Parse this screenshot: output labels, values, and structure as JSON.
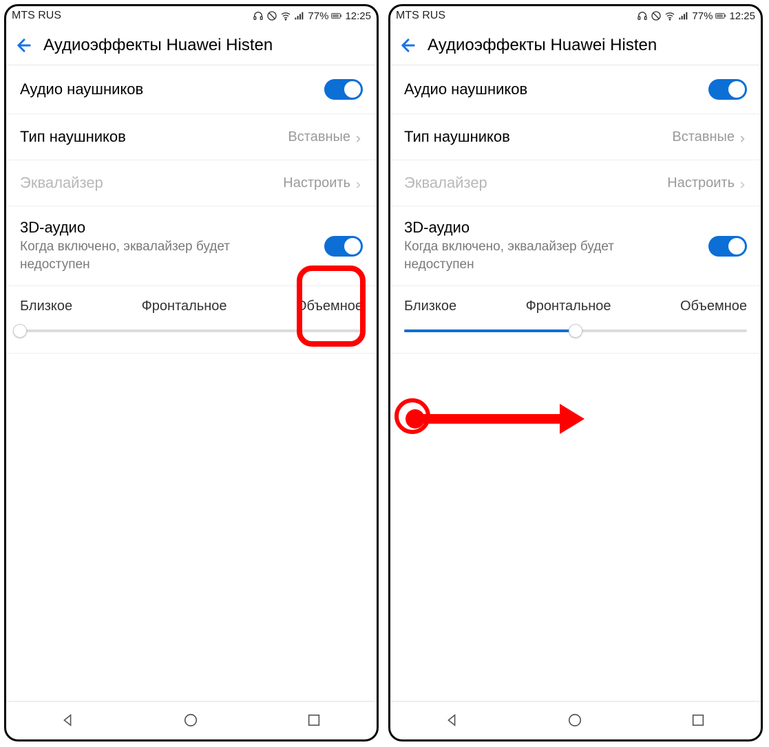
{
  "status": {
    "carrier": "MTS RUS",
    "battery": "77%",
    "time": "12:25"
  },
  "header": {
    "title": "Аудиоэффекты Huawei Histen"
  },
  "rows": {
    "headphone_audio": {
      "label": "Аудио наушников"
    },
    "headphone_type": {
      "label": "Тип наушников",
      "value": "Вставные"
    },
    "equalizer": {
      "label": "Эквалайзер",
      "value": "Настроить"
    },
    "audio3d": {
      "label": "3D-аудио",
      "sub": "Когда включено, эквалайзер будет недоступен"
    }
  },
  "slider": {
    "labels": [
      "Близкое",
      "Фронтальное",
      "Объемное"
    ],
    "left_pos_percent": 0,
    "right_pos_percent": 50
  }
}
